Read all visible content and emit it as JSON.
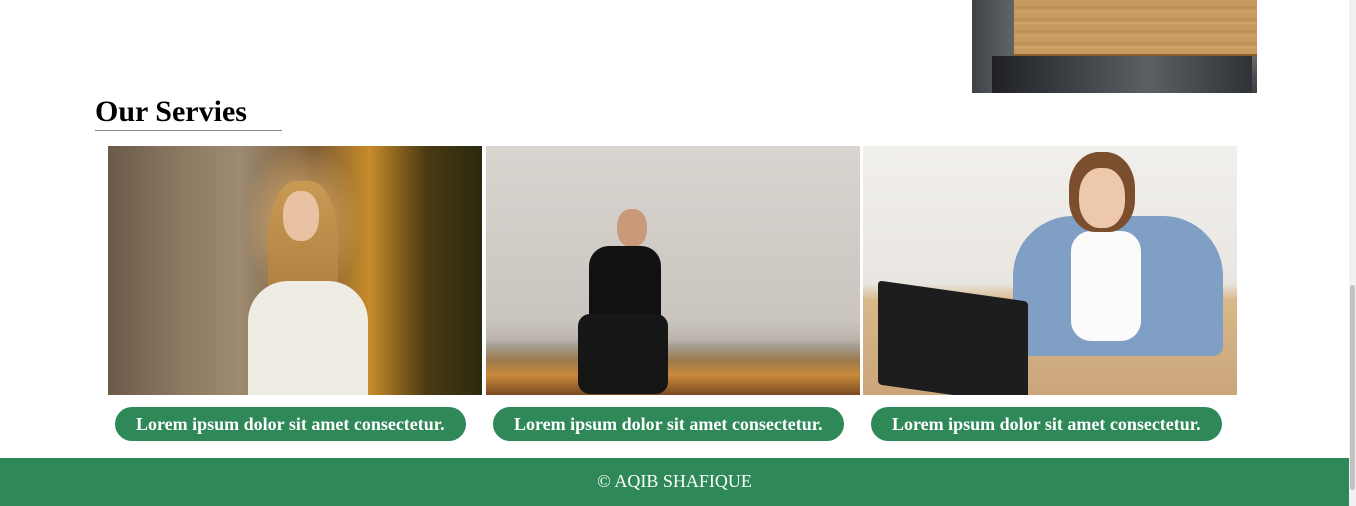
{
  "section": {
    "title": "Our Servies"
  },
  "cards": [
    {
      "image_alt": "woman-leaning-against-wooden-wall-photo",
      "button_label": "Lorem ipsum dolor sit amet consectetur."
    },
    {
      "image_alt": "man-sitting-on-curb-photo",
      "button_label": "Lorem ipsum dolor sit amet consectetur."
    },
    {
      "image_alt": "woman-at-desk-with-laptop-photo",
      "button_label": "Lorem ipsum dolor sit amet consectetur."
    }
  ],
  "footer": {
    "text": "© AQIB SHAFIQUE"
  },
  "colors": {
    "accent": "#2e8857",
    "background": "#ffffff",
    "text": "#000000",
    "button_text": "#ffffff"
  }
}
